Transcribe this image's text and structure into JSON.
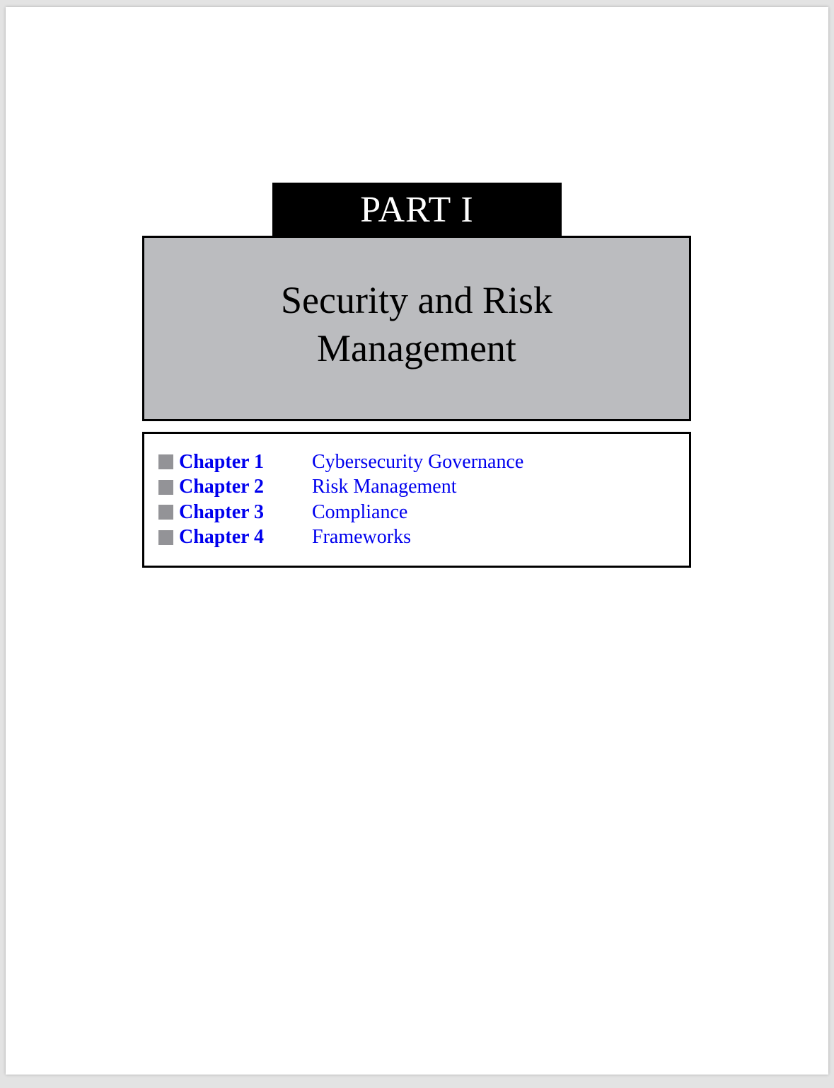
{
  "part_label": "PART I",
  "title": {
    "line1": "Security and Risk",
    "line2": "Management"
  },
  "colors": {
    "link": "#0000ee",
    "title_box_bg": "#bbbcbf",
    "bullet": "#939397",
    "part_tab_bg": "#000000"
  },
  "chapters": [
    {
      "number": "Chapter 1",
      "title": "Cybersecurity Governance"
    },
    {
      "number": "Chapter 2",
      "title": "Risk Management"
    },
    {
      "number": "Chapter 3",
      "title": "Compliance"
    },
    {
      "number": "Chapter 4",
      "title": "Frameworks"
    }
  ]
}
